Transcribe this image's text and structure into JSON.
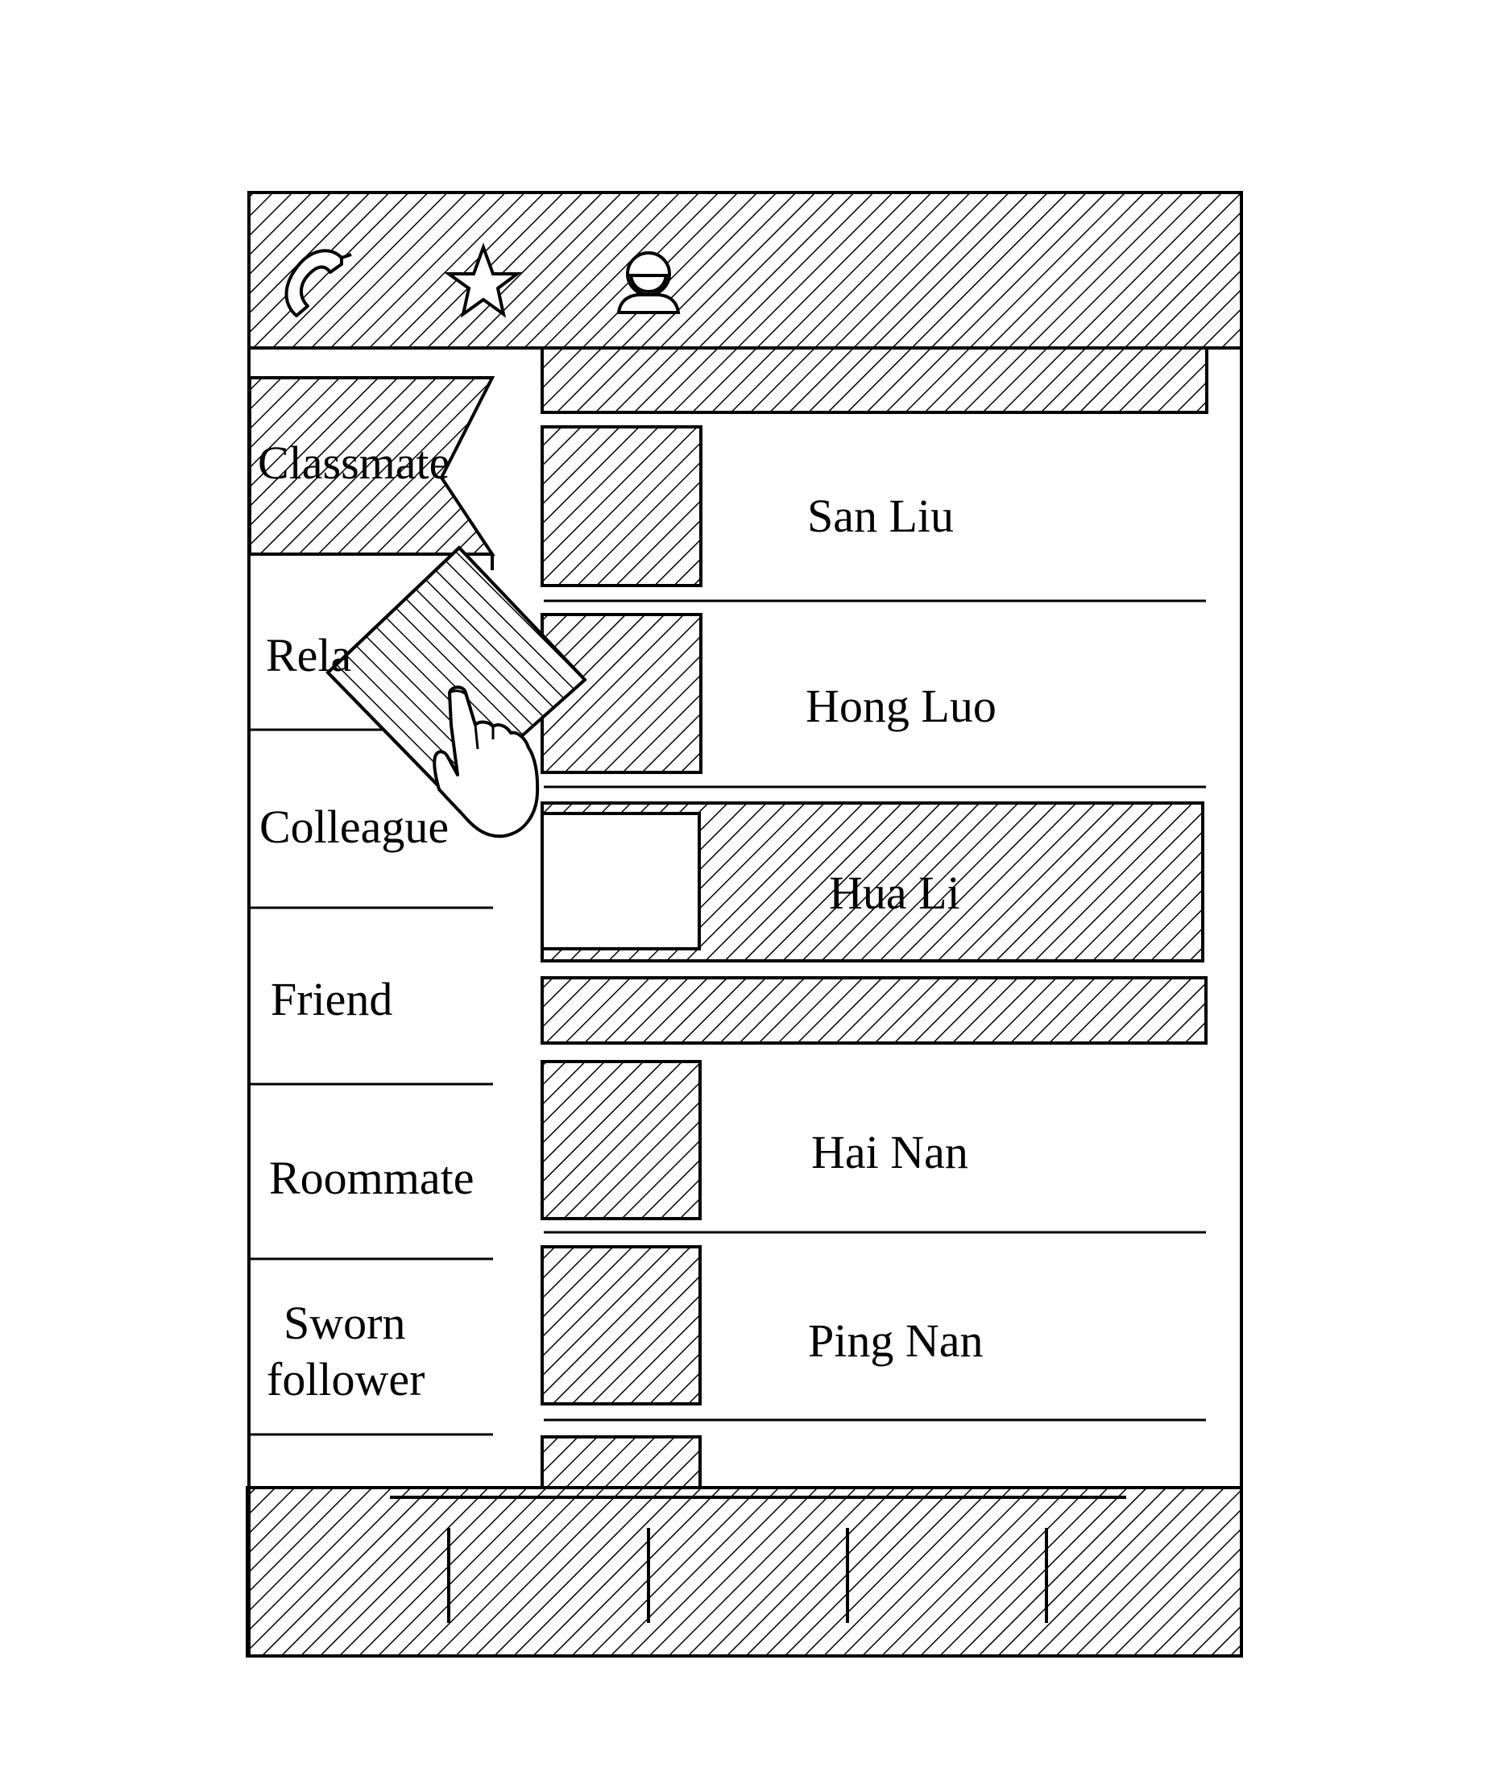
{
  "header": {
    "tabs": [
      {
        "id": "calls",
        "icon": "phone-icon"
      },
      {
        "id": "favorites",
        "icon": "star-icon"
      },
      {
        "id": "contacts",
        "icon": "contact-person-icon"
      }
    ]
  },
  "sidebar": {
    "groups": [
      {
        "label": "Classmate",
        "selected": true
      },
      {
        "label": "Rela",
        "full_label_hidden_by_drag": true
      },
      {
        "label": "Colleague"
      },
      {
        "label": "Friend"
      },
      {
        "label": "Roommate"
      },
      {
        "label_line1": "Sworn",
        "label_line2": "follower"
      }
    ]
  },
  "contacts": {
    "rows": [
      {
        "name": "San Liu",
        "avatar": "hatched"
      },
      {
        "name": "Hong Luo",
        "avatar": "hatched"
      },
      {
        "name": "Hua Li",
        "avatar": "blank",
        "highlighted": true
      },
      {
        "name": "Hai Nan",
        "avatar": "hatched"
      },
      {
        "name": "Ping Nan",
        "avatar": "hatched"
      }
    ]
  },
  "drag": {
    "item": "dragged-contact-card",
    "gesture": "finger-drag-icon"
  },
  "bottom_bar": {
    "sections": 5
  },
  "colors": {
    "line": "#000000",
    "background": "#ffffff"
  }
}
